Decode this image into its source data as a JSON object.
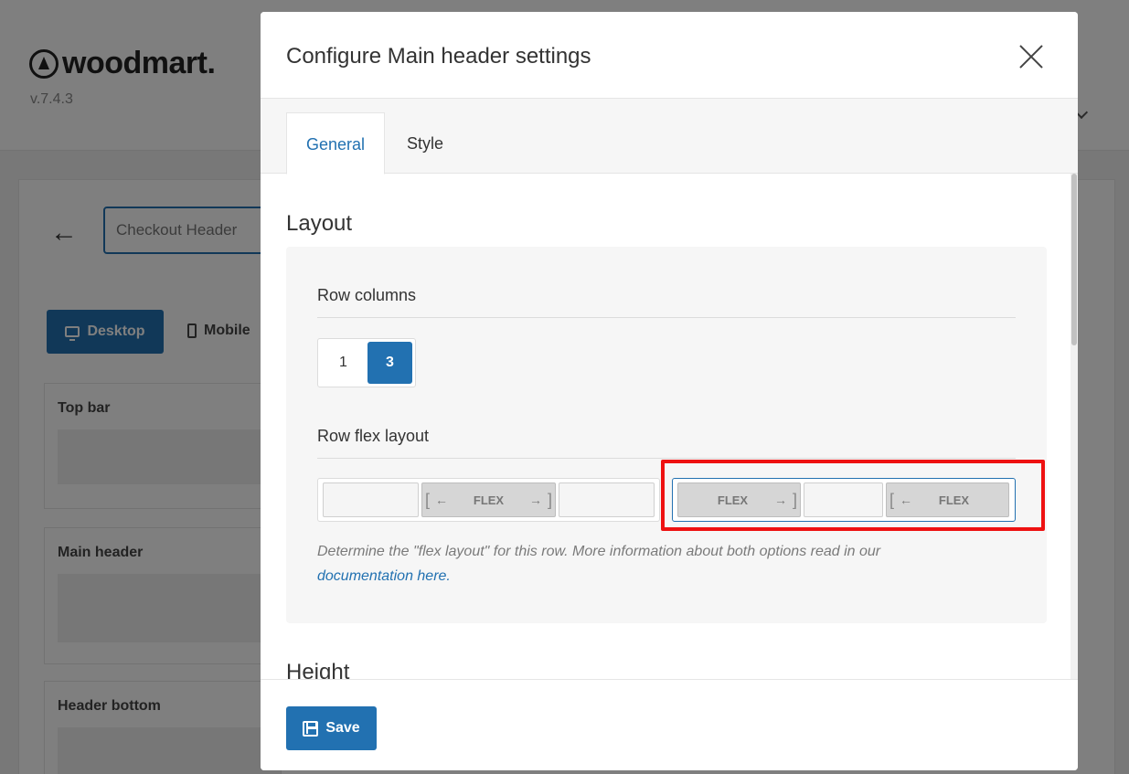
{
  "background": {
    "logo": "woodmart.",
    "version": "v.7.4.3",
    "header_name": "Checkout Header",
    "devices": [
      "Desktop",
      "Mobile"
    ],
    "sections": [
      "Top bar",
      "Main header",
      "Header bottom"
    ]
  },
  "modal": {
    "title": "Configure Main header settings",
    "tabs": [
      {
        "label": "General",
        "active": true
      },
      {
        "label": "Style",
        "active": false
      }
    ],
    "layout": {
      "title": "Layout",
      "row_columns": {
        "label": "Row columns",
        "options": [
          "1",
          "3"
        ],
        "selected": "3"
      },
      "row_flex_layout": {
        "label": "Row flex layout",
        "flex_label": "FLEX",
        "options": [
          {
            "cells": [
              "",
              "FLEX",
              ""
            ],
            "selected": false
          },
          {
            "cells": [
              "FLEX",
              "",
              "FLEX"
            ],
            "selected": true
          }
        ]
      },
      "help_text": "Determine the \"flex layout\" for this row. More information about both options read in our",
      "help_link": "documentation here."
    },
    "height_title": "Height",
    "save_label": "Save"
  },
  "colors": {
    "accent": "#2271b1",
    "highlight": "#ee1111"
  }
}
